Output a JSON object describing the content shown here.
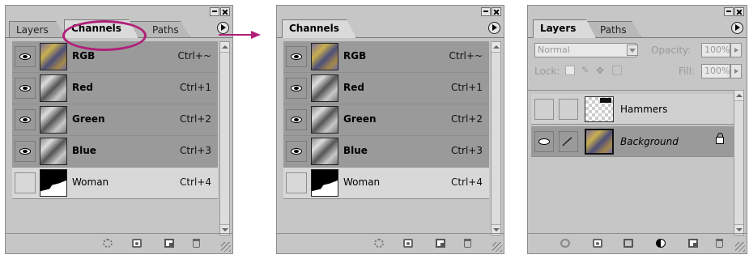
{
  "panel1": {
    "tabs": [
      "Layers",
      "Channels",
      "Paths"
    ],
    "active_tab": "Channels",
    "rows": [
      {
        "name": "RGB",
        "shortcut": "Ctrl+~",
        "visible": true,
        "selected": true,
        "thumb": "rgb"
      },
      {
        "name": "Red",
        "shortcut": "Ctrl+1",
        "visible": true,
        "selected": true,
        "thumb": "gray"
      },
      {
        "name": "Green",
        "shortcut": "Ctrl+2",
        "visible": true,
        "selected": true,
        "thumb": "gray"
      },
      {
        "name": "Blue",
        "shortcut": "Ctrl+3",
        "visible": true,
        "selected": true,
        "thumb": "gray"
      },
      {
        "name": "Woman",
        "shortcut": "Ctrl+4",
        "visible": false,
        "selected": false,
        "thumb": "mask"
      }
    ]
  },
  "panel2": {
    "tabs": [
      "Channels"
    ],
    "active_tab": "Channels",
    "rows": [
      {
        "name": "RGB",
        "shortcut": "Ctrl+~"
      },
      {
        "name": "Red",
        "shortcut": "Ctrl+1"
      },
      {
        "name": "Green",
        "shortcut": "Ctrl+2"
      },
      {
        "name": "Blue",
        "shortcut": "Ctrl+3"
      },
      {
        "name": "Woman",
        "shortcut": "Ctrl+4"
      }
    ]
  },
  "panel3": {
    "tabs": [
      "Layers",
      "Paths"
    ],
    "active_tab": "Layers",
    "blend_mode": "Normal",
    "opacity_label": "Opacity:",
    "opacity_value": "100%",
    "lock_label": "Lock:",
    "fill_label": "Fill:",
    "fill_value": "100%",
    "layers": [
      {
        "name": "Hammers"
      },
      {
        "name": "Background"
      }
    ]
  },
  "colors": {
    "highlight_ellipse": "#b02079",
    "arrow": "#b02079",
    "panel_bg": "#c6c6c6",
    "selected_row": "#9a9a9a"
  },
  "icons": [
    "eye-icon",
    "panel-menu-icon",
    "load-selection-icon",
    "save-selection-icon",
    "new-channel-icon",
    "trash-icon",
    "layer-style-icon",
    "add-mask-icon",
    "new-folder-icon",
    "adjustment-layer-icon",
    "new-layer-icon",
    "padlock-icon",
    "brush-icon"
  ]
}
